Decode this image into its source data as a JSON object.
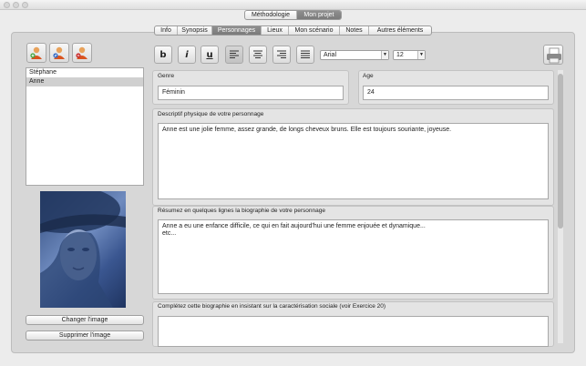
{
  "top_tabs": [
    {
      "label": "Méthodologie",
      "active": false
    },
    {
      "label": "Mon projet",
      "active": true
    }
  ],
  "sub_tabs": [
    {
      "label": "Info",
      "active": false
    },
    {
      "label": "Synopsis",
      "active": false
    },
    {
      "label": "Personnages",
      "active": true
    },
    {
      "label": "Lieux",
      "active": false
    },
    {
      "label": "Mon scénario",
      "active": false
    },
    {
      "label": "Notes",
      "active": false
    },
    {
      "label": "Autres éléments",
      "active": false
    }
  ],
  "character_toolbar": {
    "icons": [
      "add-character-icon",
      "edit-character-icon",
      "delete-character-icon"
    ]
  },
  "characters": [
    {
      "name": "Stéphane",
      "selected": false
    },
    {
      "name": "Anne",
      "selected": true
    }
  ],
  "image_buttons": {
    "change": "Changer l'image",
    "delete": "Supprimer l'image"
  },
  "format_toolbar": {
    "bold": "b",
    "italic": "i",
    "underline": "u",
    "alignments": [
      "align-left-icon",
      "align-center-icon",
      "align-right-icon",
      "align-justify-icon"
    ],
    "active_alignment": "align-left-icon",
    "font": "Arial",
    "font_size": "12"
  },
  "form": {
    "genre_label": "Genre",
    "genre_value": "Féminin",
    "age_label": "Age",
    "age_value": "24",
    "physical_label": "Descriptif physique de votre personnage",
    "physical_value": "Anne est une jolie femme, assez grande, de longs cheveux bruns. Elle est toujours souriante, joyeuse.",
    "bio_label": "Résumez en quelques lignes la biographie de votre personnage",
    "bio_value": "Anne a eu une enfance difficile, ce qui en fait aujourd'hui une femme enjouée et dynamique...\netc...",
    "social_label": "Complétez cette biographie en insistant sur la caractérisation sociale (voir Exercice 20)",
    "social_value": ""
  },
  "colors": {
    "active_tab": "#7f7f7f",
    "photo_tint": "#4a68a4"
  }
}
